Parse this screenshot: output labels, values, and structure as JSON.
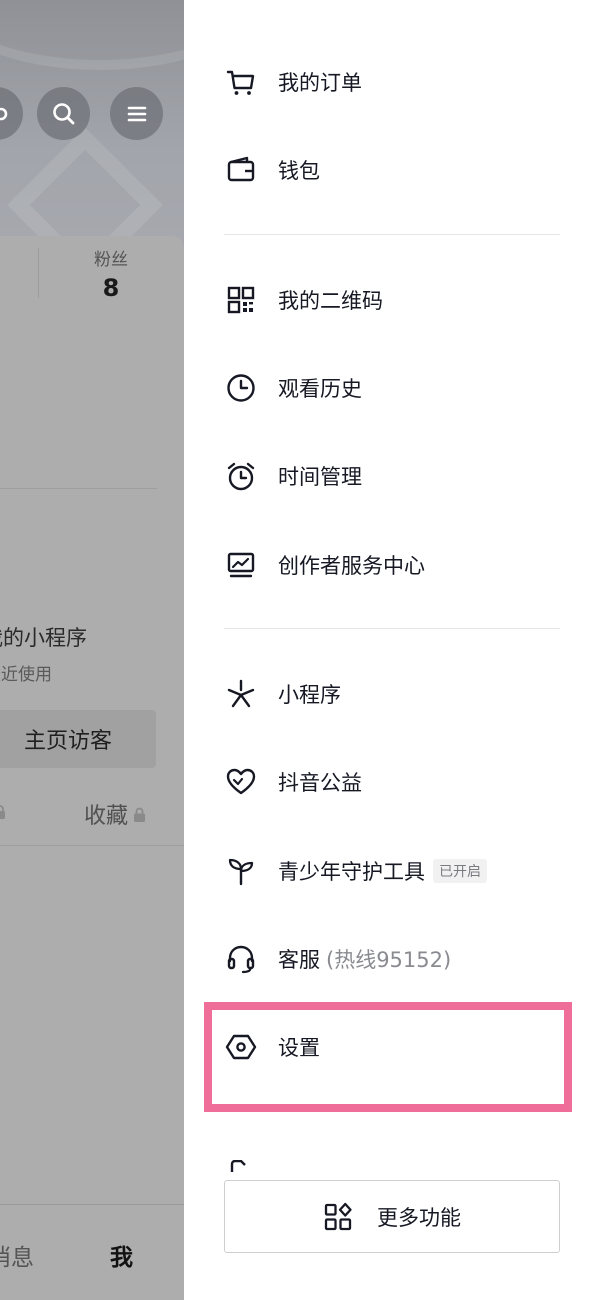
{
  "background_profile": {
    "stats": {
      "fans_label": "粉丝",
      "fans_value": "8"
    },
    "mini_program": {
      "title": "我的小程序",
      "subtitle": "最近使用"
    },
    "visitor_button": "主页访客",
    "tabs": {
      "favorites": "收藏"
    },
    "bottom_nav": {
      "messages": "消息",
      "me": "我"
    }
  },
  "drawer": {
    "items": [
      {
        "label": "我的订单",
        "icon": "cart-icon"
      },
      {
        "label": "钱包",
        "icon": "wallet-icon"
      },
      {
        "label": "我的二维码",
        "icon": "qr-code-icon"
      },
      {
        "label": "观看历史",
        "icon": "clock-icon"
      },
      {
        "label": "时间管理",
        "icon": "alarm-clock-icon"
      },
      {
        "label": "创作者服务中心",
        "icon": "creator-monitor-icon"
      },
      {
        "label": "小程序",
        "icon": "mini-program-icon"
      },
      {
        "label": "抖音公益",
        "icon": "charity-heart-icon"
      },
      {
        "label": "青少年守护工具",
        "icon": "sprout-icon",
        "badge": "已开启"
      },
      {
        "label": "客服",
        "icon": "headset-icon",
        "hotline": "(热线95152)"
      },
      {
        "label": "设置",
        "icon": "settings-hexagon-icon"
      }
    ],
    "more_button": {
      "label": "更多功能",
      "icon": "apps-grid-icon"
    }
  },
  "colors": {
    "highlight": "#ef6d99",
    "overlay": "#adadad",
    "text": "#161823"
  }
}
